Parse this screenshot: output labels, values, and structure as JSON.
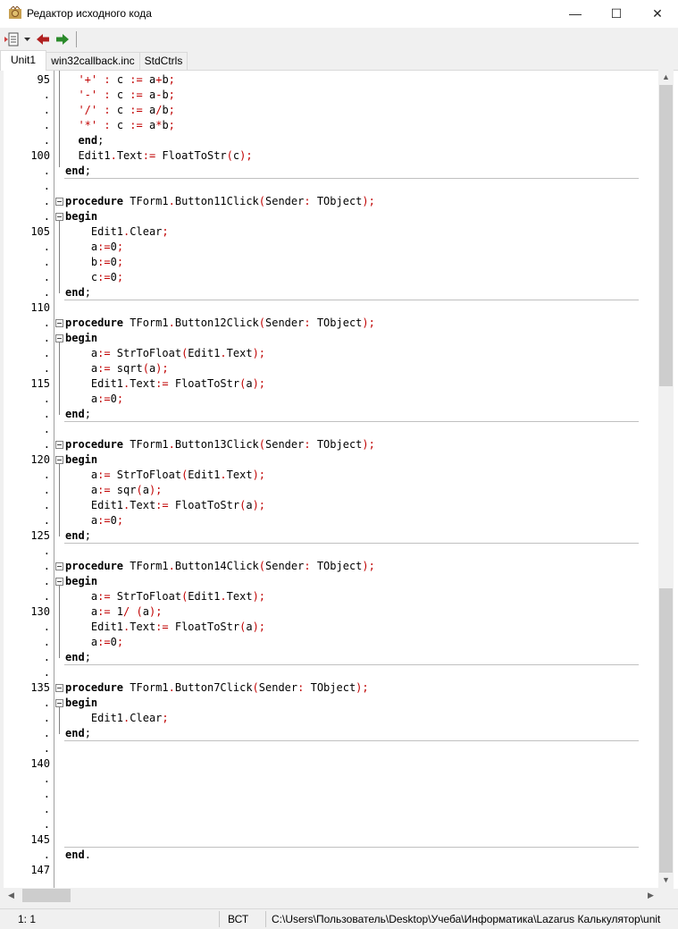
{
  "window": {
    "title": "Редактор исходного кода"
  },
  "title_buttons": {
    "minimize": "—",
    "maximize": "☐",
    "close": "✕"
  },
  "toolbar": {
    "icons": [
      "editor-menu-icon",
      "chevron-down-icon",
      "back-arrow-icon",
      "forward-arrow-icon"
    ]
  },
  "tabs": [
    {
      "label": "Unit1",
      "active": true
    },
    {
      "label": "win32callback.inc",
      "active": false
    },
    {
      "label": "StdCtrls",
      "active": false
    }
  ],
  "editor": {
    "lines": [
      {
        "n": "95",
        "code": "  '+' : c := a+b;"
      },
      {
        "n": ".",
        "code": "  '-' : c := a-b;"
      },
      {
        "n": ".",
        "code": "  '/' : c := a/b;"
      },
      {
        "n": ".",
        "code": "  '*' : c := a*b;"
      },
      {
        "n": ".",
        "code": "  end;"
      },
      {
        "n": "100",
        "code": "  Edit1.Text:= FloatToStr(c);"
      },
      {
        "n": ".",
        "code": "end;"
      },
      {
        "n": ".",
        "code": ""
      },
      {
        "n": ".",
        "code": "procedure TForm1.Button11Click(Sender: TObject);"
      },
      {
        "n": ".",
        "code": "begin"
      },
      {
        "n": "105",
        "code": "    Edit1.Clear;"
      },
      {
        "n": ".",
        "code": "    a:=0;"
      },
      {
        "n": ".",
        "code": "    b:=0;"
      },
      {
        "n": ".",
        "code": "    c:=0;"
      },
      {
        "n": ".",
        "code": "end;"
      },
      {
        "n": "110",
        "code": ""
      },
      {
        "n": ".",
        "code": "procedure TForm1.Button12Click(Sender: TObject);"
      },
      {
        "n": ".",
        "code": "begin"
      },
      {
        "n": ".",
        "code": "    a:= StrToFloat(Edit1.Text);"
      },
      {
        "n": ".",
        "code": "    a:= sqrt(a);"
      },
      {
        "n": "115",
        "code": "    Edit1.Text:= FloatToStr(a);"
      },
      {
        "n": ".",
        "code": "    a:=0;"
      },
      {
        "n": ".",
        "code": "end;"
      },
      {
        "n": ".",
        "code": ""
      },
      {
        "n": ".",
        "code": "procedure TForm1.Button13Click(Sender: TObject);"
      },
      {
        "n": "120",
        "code": "begin"
      },
      {
        "n": ".",
        "code": "    a:= StrToFloat(Edit1.Text);"
      },
      {
        "n": ".",
        "code": "    a:= sqr(a);"
      },
      {
        "n": ".",
        "code": "    Edit1.Text:= FloatToStr(a);"
      },
      {
        "n": ".",
        "code": "    a:=0;"
      },
      {
        "n": "125",
        "code": "end;"
      },
      {
        "n": ".",
        "code": ""
      },
      {
        "n": ".",
        "code": "procedure TForm1.Button14Click(Sender: TObject);"
      },
      {
        "n": ".",
        "code": "begin"
      },
      {
        "n": ".",
        "code": "    a:= StrToFloat(Edit1.Text);"
      },
      {
        "n": "130",
        "code": "    a:= 1/ (a);"
      },
      {
        "n": ".",
        "code": "    Edit1.Text:= FloatToStr(a);"
      },
      {
        "n": ".",
        "code": "    a:=0;"
      },
      {
        "n": ".",
        "code": "end;"
      },
      {
        "n": ".",
        "code": ""
      },
      {
        "n": "135",
        "code": "procedure TForm1.Button7Click(Sender: TObject);"
      },
      {
        "n": ".",
        "code": "begin"
      },
      {
        "n": ".",
        "code": "    Edit1.Clear;"
      },
      {
        "n": ".",
        "code": "end;"
      },
      {
        "n": ".",
        "code": ""
      },
      {
        "n": "140",
        "code": ""
      },
      {
        "n": ".",
        "code": ""
      },
      {
        "n": ".",
        "code": ""
      },
      {
        "n": ".",
        "code": ""
      },
      {
        "n": ".",
        "code": ""
      },
      {
        "n": "145",
        "code": ""
      },
      {
        "n": ".",
        "code": "end."
      },
      {
        "n": "147",
        "code": ""
      }
    ]
  },
  "statusbar": {
    "position": "1:  1",
    "mode": "ВСТ",
    "path": "C:\\Users\\Пользователь\\Desktop\\Учеба\\Информатика\\Lazarus Калькулятор\\unit"
  }
}
